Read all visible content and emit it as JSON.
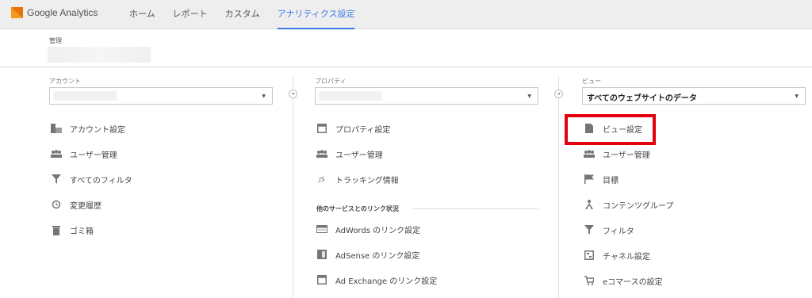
{
  "header": {
    "app_name": "Google Analytics",
    "tabs": [
      {
        "label": "ホーム"
      },
      {
        "label": "レポート"
      },
      {
        "label": "カスタム"
      },
      {
        "label": "アナリティクス設定",
        "active": true
      }
    ]
  },
  "admin": {
    "label": "管理"
  },
  "account": {
    "label": "アカウント",
    "items": [
      {
        "label": "アカウント設定",
        "icon": "building-icon"
      },
      {
        "label": "ユーザー管理",
        "icon": "users-icon"
      },
      {
        "label": "すべてのフィルタ",
        "icon": "filter-icon"
      },
      {
        "label": "変更履歴",
        "icon": "history-icon"
      },
      {
        "label": "ゴミ箱",
        "icon": "trash-icon"
      }
    ]
  },
  "property": {
    "label": "プロパティ",
    "items": [
      {
        "label": "プロパティ設定",
        "icon": "window-icon"
      },
      {
        "label": "ユーザー管理",
        "icon": "users-icon"
      },
      {
        "label": "トラッキング情報",
        "icon": "js-icon",
        "icon_text": "JS"
      }
    ],
    "section_title": "他のサービスとのリンク状況",
    "link_items": [
      {
        "label": "AdWords のリンク設定",
        "icon": "adwords-icon"
      },
      {
        "label": "AdSense のリンク設定",
        "icon": "adsense-icon"
      },
      {
        "label": "Ad Exchange のリンク設定",
        "icon": "adexchange-icon"
      }
    ]
  },
  "view": {
    "label": "ビュー",
    "selected": "すべてのウェブサイトのデータ",
    "items": [
      {
        "label": "ビュー設定",
        "icon": "document-icon"
      },
      {
        "label": "ユーザー管理",
        "icon": "users-icon"
      },
      {
        "label": "目標",
        "icon": "flag-icon"
      },
      {
        "label": "コンテンツグループ",
        "icon": "person-icon"
      },
      {
        "label": "フィルタ",
        "icon": "filter-icon"
      },
      {
        "label": "チャネル設定",
        "icon": "channel-icon"
      },
      {
        "label": "eコマースの設定",
        "icon": "cart-icon"
      }
    ]
  },
  "colors": {
    "accent": "#3b78e7",
    "highlight": "#e3000f",
    "icon": "#757575"
  }
}
